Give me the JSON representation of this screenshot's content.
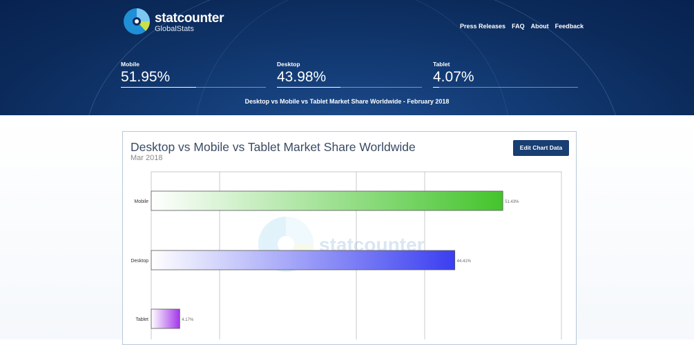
{
  "brand": {
    "name": "statcounter",
    "sub": "GlobalStats"
  },
  "nav": [
    {
      "label": "Press Releases"
    },
    {
      "label": "FAQ"
    },
    {
      "label": "About"
    },
    {
      "label": "Feedback"
    }
  ],
  "stats": [
    {
      "label": "Mobile",
      "value": "51.95%",
      "share": 0.5195
    },
    {
      "label": "Desktop",
      "value": "43.98%",
      "share": 0.4398
    },
    {
      "label": "Tablet",
      "value": "4.07%",
      "share": 0.0407
    }
  ],
  "headline": "Desktop vs Mobile vs Tablet Market Share Worldwide - February 2018",
  "card": {
    "title": "Desktop vs Mobile vs Tablet Market Share Worldwide",
    "date": "Mar 2018",
    "edit_label": "Edit Chart Data"
  },
  "watermark": "statcounter",
  "chart_data": {
    "type": "bar",
    "orientation": "horizontal",
    "categories": [
      "Mobile",
      "Desktop",
      "Tablet"
    ],
    "values": [
      51.43,
      44.41,
      4.17
    ],
    "value_labels": [
      "51.43%",
      "44.41%",
      "4.17%"
    ],
    "colors": [
      "#44c42c",
      "#3a3ef0",
      "#a238e8"
    ],
    "xlim": [
      0,
      60
    ],
    "grid": true
  }
}
